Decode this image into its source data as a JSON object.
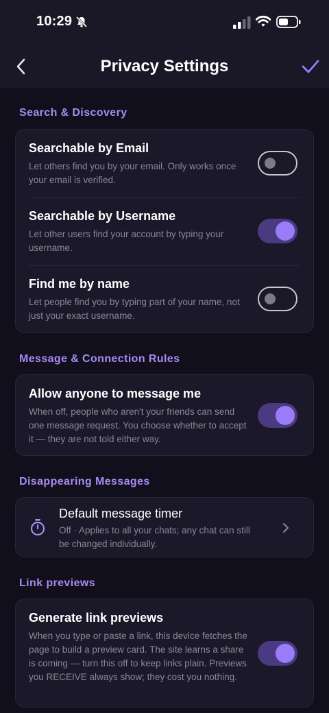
{
  "status_bar": {
    "time": "10:29"
  },
  "header": {
    "title": "Privacy Settings"
  },
  "sections": {
    "search": {
      "label": "Search & Discovery",
      "rows": [
        {
          "title": "Searchable by Email",
          "desc": "Let others find you by your email. Only works once your email is verified.",
          "enabled": false
        },
        {
          "title": "Searchable by Username",
          "desc": "Let other users find your account by typing your username.",
          "enabled": true
        },
        {
          "title": "Find me by name",
          "desc": "Let people find you by typing part of your name, not just your exact username.",
          "enabled": false
        }
      ]
    },
    "message": {
      "label": "Message & Connection Rules",
      "rows": [
        {
          "title": "Allow anyone to message me",
          "desc": "When off, people who aren't your friends can send one message request. You choose whether to accept it — they are not told either way.",
          "enabled": true
        }
      ]
    },
    "disappearing": {
      "label": "Disappearing Messages",
      "timer": {
        "title": "Default message timer",
        "desc": "Off · Applies to all your chats; any chat can still be changed individually.",
        "icon": "timer-icon"
      }
    },
    "links": {
      "label": "Link previews",
      "rows": [
        {
          "title": "Generate link previews",
          "desc": "When you type or paste a link, this device fetches the page to build a preview card. The site learns a share is coming — turn this off to keep links plain. Previews you RECEIVE always show; they cost you nothing.",
          "enabled": true
        }
      ]
    }
  },
  "colors": {
    "accent": "#a68bf2",
    "toggle_on_track": "#4a3a82",
    "toggle_on_knob": "#9b7cf7",
    "background": "#120f1c",
    "card": "#1b1829"
  }
}
